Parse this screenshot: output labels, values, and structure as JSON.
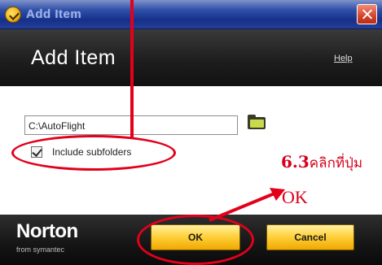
{
  "window": {
    "title": "Add Item",
    "header_title": "Add Item",
    "help_link": "Help",
    "icons": {
      "app": "norton-check-icon",
      "close": "close-icon",
      "browse": "folder-browse-icon"
    }
  },
  "form": {
    "path_value": "C:\\AutoFlight",
    "include_subfolders_label": "Include subfolders",
    "include_subfolders_checked": true
  },
  "footer": {
    "brand": "Norton",
    "brand_sub": "from symantec",
    "ok_label": "OK",
    "cancel_label": "Cancel"
  },
  "annotation": {
    "step_number": "6.3",
    "step_text": "คลิกที่ปุ่ม",
    "target_label": "OK",
    "color": "#e3001b"
  },
  "colors": {
    "titlebar": "#2f4fa8",
    "header": "#1e1e1e",
    "button": "#ffd23d"
  }
}
